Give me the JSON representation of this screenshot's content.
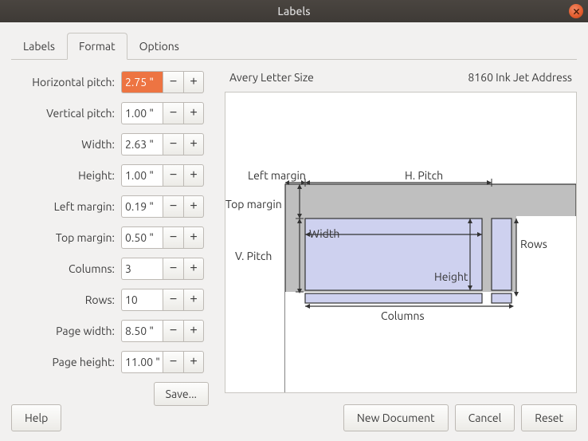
{
  "window": {
    "title": "Labels"
  },
  "tabs": {
    "labels": "Labels",
    "format": "Format",
    "options": "Options"
  },
  "fields": {
    "hpitch": {
      "label": "Horizontal pitch:",
      "value": "2.75 \""
    },
    "vpitch": {
      "label": "Vertical pitch:",
      "value": "1.00 \""
    },
    "width": {
      "label": "Width:",
      "value": "2.63 \""
    },
    "height": {
      "label": "Height:",
      "value": "1.00 \""
    },
    "lmargin": {
      "label": "Left margin:",
      "value": "0.19 \""
    },
    "tmargin": {
      "label": "Top margin:",
      "value": "0.50 \""
    },
    "cols": {
      "label": "Columns:",
      "value": "3"
    },
    "rows": {
      "label": "Rows:",
      "value": "10"
    },
    "pwidth": {
      "label": "Page width:",
      "value": "8.50 \""
    },
    "pheight": {
      "label": "Page height:",
      "value": "11.00 \""
    }
  },
  "spin": {
    "minus": "−",
    "plus": "+"
  },
  "buttons": {
    "save": "Save...",
    "help": "Help",
    "newdoc": "New Document",
    "cancel": "Cancel",
    "reset": "Reset"
  },
  "preview": {
    "brand": "Avery Letter Size",
    "type": "8160 Ink Jet Address",
    "diagram": {
      "left_margin": "Left margin",
      "top_margin": "Top margin",
      "hpitch": "H. Pitch",
      "vpitch": "V. Pitch",
      "width": "Width",
      "height": "Height",
      "columns": "Columns",
      "rows": "Rows"
    }
  }
}
